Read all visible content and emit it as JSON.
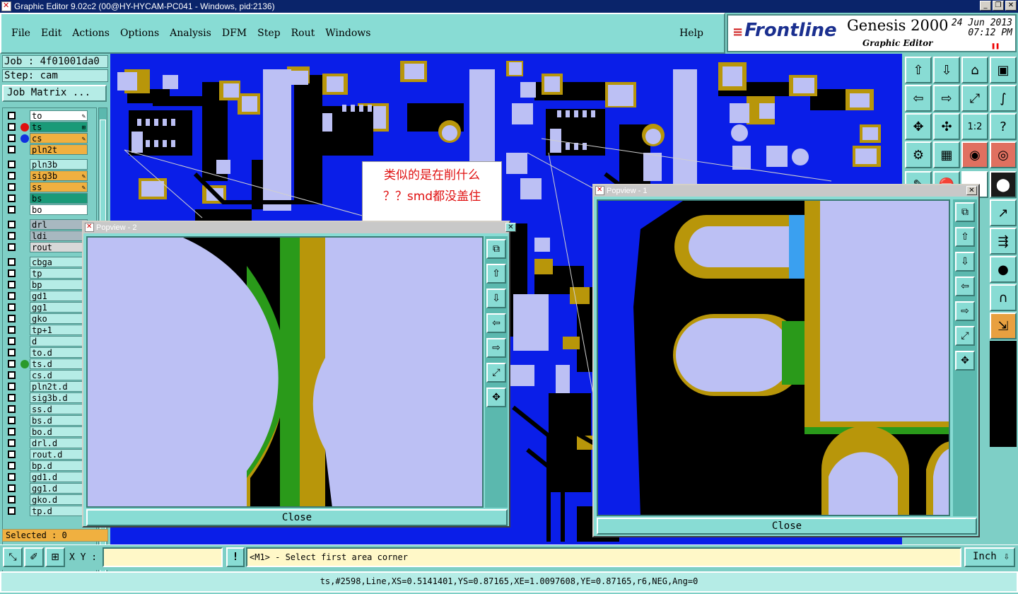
{
  "window": {
    "title": "Graphic Editor 9.02c2 (00@HY-HYCAM-PC041 - Windows, pid:2136)",
    "minimize": "_",
    "restore": "❐",
    "close": "✕"
  },
  "menu": {
    "items": [
      "File",
      "Edit",
      "Actions",
      "Options",
      "Analysis",
      "DFM",
      "Step",
      "Rout",
      "Windows"
    ],
    "help": "Help"
  },
  "brand": {
    "logo": "Frontline",
    "product": "Genesis 2000",
    "subtitle": "Graphic Editor",
    "date": "24 Jun 2013",
    "time": "07:12 PM"
  },
  "job": {
    "job_line": "Job : 4f01001da0",
    "step_line": "Step: cam",
    "matrix_button": "Job Matrix ..."
  },
  "layers": [
    {
      "name": "to",
      "color": "#ffffff",
      "dot": "",
      "tail": "✎"
    },
    {
      "name": "ts",
      "color": "#1a9a78",
      "dot": "#e01010",
      "tail": "⊞"
    },
    {
      "name": "cs",
      "color": "#f0b040",
      "dot": "#1030e0",
      "tail": "✎"
    },
    {
      "name": "pln2t",
      "color": "#f0b040",
      "dot": "",
      "tail": ""
    },
    {
      "name": "pln3b",
      "color": "#b5ece6",
      "dot": "",
      "tail": ""
    },
    {
      "name": "sig3b",
      "color": "#f0b040",
      "dot": "",
      "tail": "✎"
    },
    {
      "name": "ss",
      "color": "#f0b040",
      "dot": "",
      "tail": "✎"
    },
    {
      "name": "bs",
      "color": "#1a9a78",
      "dot": "",
      "tail": ""
    },
    {
      "name": "bo",
      "color": "#ffffff",
      "dot": "",
      "tail": ""
    },
    {
      "name": "drl",
      "color": "#a8b8c0",
      "dot": "",
      "tail": ""
    },
    {
      "name": "ldi",
      "color": "#a8b8c0",
      "dot": "",
      "tail": ""
    },
    {
      "name": "rout",
      "color": "#d8d8d8",
      "dot": "",
      "tail": ""
    },
    {
      "name": "cbga",
      "color": "#b5ece6",
      "dot": "",
      "tail": ""
    },
    {
      "name": "tp",
      "color": "#b5ece6",
      "dot": "",
      "tail": ""
    },
    {
      "name": "bp",
      "color": "#b5ece6",
      "dot": "",
      "tail": ""
    },
    {
      "name": "gd1",
      "color": "#b5ece6",
      "dot": "",
      "tail": "✎"
    },
    {
      "name": "gg1",
      "color": "#b5ece6",
      "dot": "",
      "tail": "✎"
    },
    {
      "name": "gko",
      "color": "#b5ece6",
      "dot": "",
      "tail": ""
    },
    {
      "name": "tp+1",
      "color": "#b5ece6",
      "dot": "",
      "tail": ""
    },
    {
      "name": "d",
      "color": "#b5ece6",
      "dot": "",
      "tail": ""
    },
    {
      "name": "to.d",
      "color": "#b5ece6",
      "dot": "",
      "tail": "✎"
    },
    {
      "name": "ts.d",
      "color": "#b5ece6",
      "dot": "#2a9a2a",
      "tail": ""
    },
    {
      "name": "cs.d",
      "color": "#b5ece6",
      "dot": "",
      "tail": "✎"
    },
    {
      "name": "pln2t.d",
      "color": "#b5ece6",
      "dot": "",
      "tail": ""
    },
    {
      "name": "sig3b.d",
      "color": "#b5ece6",
      "dot": "",
      "tail": "✎"
    },
    {
      "name": "ss.d",
      "color": "#b5ece6",
      "dot": "",
      "tail": "✎"
    },
    {
      "name": "bs.d",
      "color": "#b5ece6",
      "dot": "",
      "tail": ""
    },
    {
      "name": "bo.d",
      "color": "#b5ece6",
      "dot": "",
      "tail": ""
    },
    {
      "name": "drl.d",
      "color": "#b5ece6",
      "dot": "",
      "tail": ""
    },
    {
      "name": "rout.d",
      "color": "#b5ece6",
      "dot": "",
      "tail": ""
    },
    {
      "name": "bp.d",
      "color": "#b5ece6",
      "dot": "",
      "tail": ""
    },
    {
      "name": "gd1.d",
      "color": "#b5ece6",
      "dot": "",
      "tail": "✎"
    },
    {
      "name": "gg1.d",
      "color": "#b5ece6",
      "dot": "",
      "tail": "✎"
    },
    {
      "name": "gko.d",
      "color": "#b5ece6",
      "dot": "",
      "tail": ""
    },
    {
      "name": "tp.d",
      "color": "#b5ece6",
      "dot": "",
      "tail": ""
    }
  ],
  "selected": "Selected : 0",
  "popview2": {
    "title": "Popview - 2",
    "close_label": "Close",
    "close_x": "✕"
  },
  "popview1": {
    "title": "Popview - 1",
    "close_label": "Close",
    "close_x": "✕"
  },
  "note": {
    "line1": "类似的是在削什么",
    "line2": "？？smd都没盖住"
  },
  "bottom": {
    "xy_label": "X Y :",
    "xy_value": "",
    "excl": "!",
    "prompt": "<M1> - Select first area corner",
    "unit": "Inch"
  },
  "status": "ts,#2598,Line,XS=0.5141401,YS=0.87165,XE=1.0097608,YE=0.87165,r6,NEG,Ang=0",
  "colors": {
    "board": "#0a1ee8",
    "pad": "#bcc0f4",
    "copper": "#b8960a",
    "solder": "#2a9a1a",
    "black": "#000000"
  },
  "tools": [
    {
      "icon": "import-top-icon",
      "glyph": "⇧"
    },
    {
      "icon": "export-icon",
      "glyph": "⇩"
    },
    {
      "icon": "home-icon",
      "glyph": "⌂"
    },
    {
      "icon": "window-icon",
      "glyph": "▣"
    },
    {
      "icon": "zoom-back-icon",
      "glyph": "⇦"
    },
    {
      "icon": "zoom-forward-icon",
      "glyph": "⇨"
    },
    {
      "icon": "zoom-fit-icon",
      "glyph": "⤢"
    },
    {
      "icon": "snake-icon",
      "glyph": "∫"
    },
    {
      "icon": "zoom-home-icon",
      "glyph": "✥"
    },
    {
      "icon": "pan-icon",
      "glyph": "✣"
    },
    {
      "icon": "scale-icon",
      "glyph": "1:2"
    },
    {
      "icon": "help-icon",
      "glyph": "?"
    },
    {
      "icon": "measure-icon",
      "glyph": "⚙"
    },
    {
      "icon": "grid-icon",
      "glyph": "▦"
    },
    {
      "icon": "layer-red-icon",
      "glyph": "◉"
    },
    {
      "icon": "layer-select-icon",
      "glyph": "◎"
    }
  ],
  "tools2": [
    {
      "icon": "draw-icon",
      "glyph": "✎"
    },
    {
      "icon": "stop-icon",
      "glyph": "⛔"
    },
    {
      "icon": "blank-icon",
      "glyph": ""
    },
    {
      "icon": "dot-icon",
      "glyph": "⬤"
    }
  ],
  "right_partial": [
    {
      "icon": "net-icon",
      "glyph": "↗"
    },
    {
      "icon": "net-ff-icon",
      "glyph": "⇶"
    },
    {
      "icon": "blob-icon",
      "glyph": "●"
    },
    {
      "icon": "arc-icon",
      "glyph": "∩"
    },
    {
      "icon": "route-icon",
      "glyph": "⇲"
    }
  ],
  "pop_side": [
    {
      "icon": "copy-icon",
      "glyph": "⧉"
    },
    {
      "icon": "up-icon",
      "glyph": "⇧"
    },
    {
      "icon": "down-icon",
      "glyph": "⇩"
    },
    {
      "icon": "left-icon",
      "glyph": "⇦"
    },
    {
      "icon": "right-icon",
      "glyph": "⇨"
    },
    {
      "icon": "fit-icon",
      "glyph": "⤢"
    },
    {
      "icon": "center-icon",
      "glyph": "✥"
    }
  ],
  "bottom_tools": [
    {
      "icon": "zoom-area-icon",
      "glyph": "⤡"
    },
    {
      "icon": "edit-area-icon",
      "glyph": "✐"
    },
    {
      "icon": "snap-grid-icon",
      "glyph": "⊞"
    }
  ]
}
